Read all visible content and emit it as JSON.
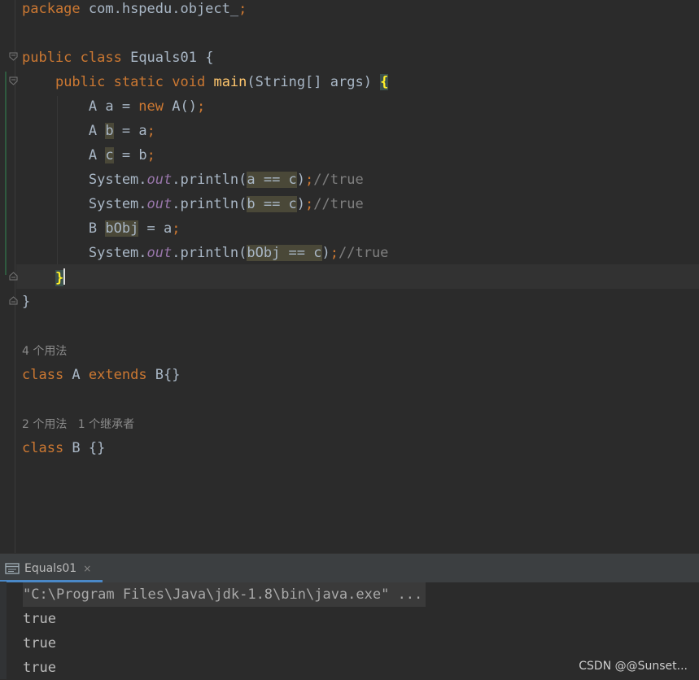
{
  "editor": {
    "package_kw": "package",
    "package_name": " com.hspedu.object_",
    "package_semicolon": ";",
    "class_line": {
      "public": "public",
      "class": " class",
      "name": " Equals01 {"
    },
    "main_line": {
      "indent": "    ",
      "public": "public",
      "static": " static",
      "void": " void",
      "main": " main",
      "params": "(String[] args) ",
      "brace": "{"
    },
    "lines": {
      "l1_a": "        A a = ",
      "l1_new": "new",
      "l1_b": " A()",
      "l1_semi": ";",
      "l2_a": "        A ",
      "l2_var": "b",
      "l2_b": " = a",
      "l2_semi": ";",
      "l3_a": "        A ",
      "l3_var": "c",
      "l3_b": " = b",
      "l3_semi": ";",
      "l4_a": "        System.",
      "l4_out": "out",
      "l4_b": ".println(",
      "l4_expr": "a == c",
      "l4_c": ")",
      "l4_semi": ";",
      "l4_cmt": "//true",
      "l5_a": "        System.",
      "l5_out": "out",
      "l5_b": ".println(",
      "l5_expr": "b == c",
      "l5_c": ")",
      "l5_semi": ";",
      "l5_cmt": "//true",
      "l6_a": "        B ",
      "l6_var": "bObj",
      "l6_b": " = a",
      "l6_semi": ";",
      "l7_a": "        System.",
      "l7_out": "out",
      "l7_b": ".println(",
      "l7_expr": "bObj == c",
      "l7_c": ")",
      "l7_semi": ";",
      "l7_cmt": "//true",
      "close_main_indent": "    ",
      "close_main": "}",
      "close_class": "}"
    },
    "usage_a": "4 个用法",
    "class_a_kw": "class",
    "class_a_name": " A ",
    "class_a_extends": "extends",
    "class_a_rest": " B{}",
    "usage_b": "2 个用法   1 个继承者",
    "class_b_kw": "class",
    "class_b_rest": " B {}"
  },
  "run_panel": {
    "tab_label": "Equals01",
    "close_symbol": "×",
    "command": "\"C:\\Program Files\\Java\\jdk-1.8\\bin\\java.exe\" ...",
    "output": [
      "true",
      "true",
      "true"
    ]
  },
  "watermark": "CSDN @@Sunset...",
  "icons": [
    "fold-icon",
    "run-tab-icon",
    "close-icon"
  ],
  "colors": {
    "background": "#2b2b2b",
    "keyword": "#cc7832",
    "function": "#ffc66d",
    "field": "#9876aa",
    "comment": "#808080",
    "text": "#a9b7c6"
  }
}
